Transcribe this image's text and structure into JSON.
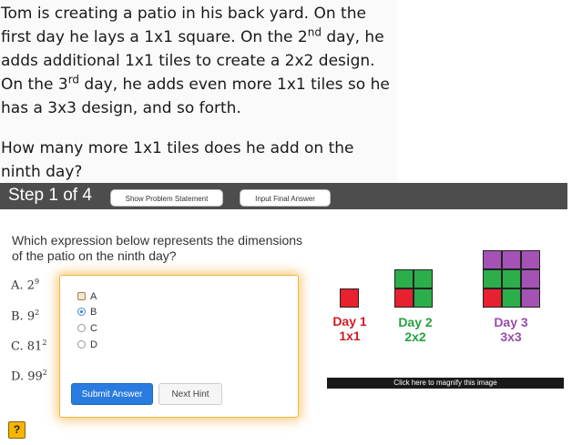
{
  "problem": {
    "p1_a": "Tom is creating a patio in his back yard.  On the first day he lays a 1x1 square.  On the 2",
    "p1_sup1": "nd",
    "p1_b": " day, he adds additional 1x1 tiles to create a 2x2 design.  On the 3",
    "p1_sup2": "rd",
    "p1_c": " day, he adds even more 1x1 tiles so he has a 3x3 design, and so forth.",
    "p2": "How many more 1x1 tiles does he add on the ninth day?"
  },
  "stepbar": {
    "title": "Step 1 of 4",
    "show_problem": "Show Problem Statement",
    "input_final": "Input Final Answer"
  },
  "question": {
    "text": "Which expression below represents the dimensions of the patio on the ninth day?",
    "options": [
      {
        "letter": "A.",
        "base": "2",
        "exp": "9"
      },
      {
        "letter": "B.",
        "base": "9",
        "exp": "2"
      },
      {
        "letter": "C.",
        "base": "81",
        "exp": "2"
      },
      {
        "letter": "D.",
        "base": "99",
        "exp": "2"
      }
    ]
  },
  "answer_box": {
    "choices": [
      "A",
      "B",
      "C",
      "D"
    ],
    "submit_label": "Submit Answer",
    "hint_label": "Next Hint"
  },
  "figure": {
    "days": [
      {
        "line1": "Day 1",
        "line2": "1x1",
        "color": "#e8212e"
      },
      {
        "line1": "Day 2",
        "line2": "2x2",
        "color": "#2cae4b"
      },
      {
        "line1": "Day 3",
        "line2": "3x3",
        "color": "#a552b5"
      }
    ],
    "magnify": "Click here to magnify this image"
  },
  "help_label": "?"
}
